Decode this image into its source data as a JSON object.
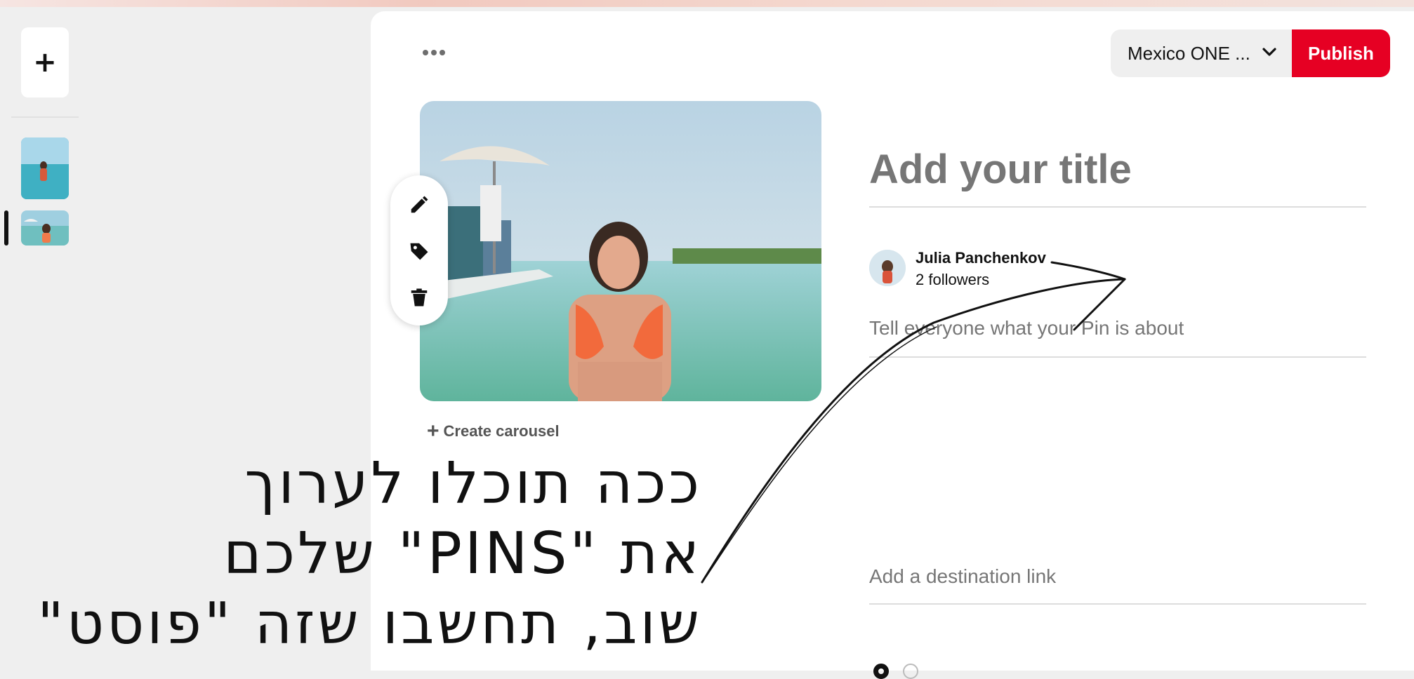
{
  "sidebar": {
    "add_label": "+",
    "thumbnails": [
      {
        "name": "draft-1",
        "active": false
      },
      {
        "name": "draft-2",
        "active": true
      }
    ]
  },
  "header": {
    "more_icon": "more-horizontal-icon",
    "board_select": {
      "value": "Mexico ONE ...",
      "icon": "chevron-down-icon"
    },
    "publish_label": "Publish",
    "publish_color": "#e60023"
  },
  "editor": {
    "tools": [
      "edit-pencil-icon",
      "tag-icon",
      "trash-icon"
    ],
    "create_carousel": "Create carousel"
  },
  "form": {
    "title_placeholder": "Add your title",
    "author": {
      "name": "Julia Panchenkov",
      "followers": "2 followers"
    },
    "description_placeholder": "Tell everyone what your Pin is about",
    "link_placeholder": "Add a destination link"
  },
  "overlay": {
    "lines": [
      "ככה תוכלו לערוך",
      "את \"PINS\" שלכם",
      "שוב, תחשבו שזה \"פוסט\""
    ]
  }
}
